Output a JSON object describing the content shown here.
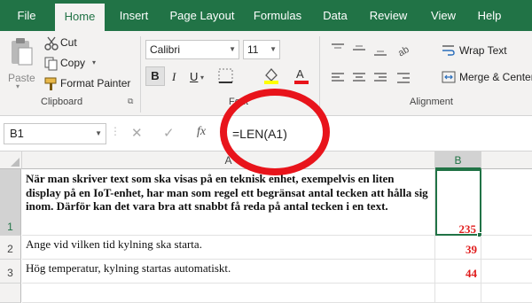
{
  "ribbon_tabs": [
    {
      "label": "File"
    },
    {
      "label": "Home",
      "active": true
    },
    {
      "label": "Insert"
    },
    {
      "label": "Page Layout"
    },
    {
      "label": "Formulas"
    },
    {
      "label": "Data"
    },
    {
      "label": "Review"
    },
    {
      "label": "View"
    },
    {
      "label": "Help"
    }
  ],
  "clipboard": {
    "paste_label": "Paste",
    "cut_label": "Cut",
    "copy_label": "Copy",
    "format_painter_label": "Format Painter",
    "group_label": "Clipboard"
  },
  "font": {
    "family": "Calibri",
    "size": "11",
    "bold": "B",
    "italic": "I",
    "underline": "U",
    "group_label": "Font"
  },
  "alignment": {
    "wrap_text_label": "Wrap Text",
    "merge_center_label": "Merge & Center",
    "group_label": "Alignment"
  },
  "formula_bar": {
    "name_box": "B1",
    "fx_label": "fx",
    "formula": "=LEN(A1)"
  },
  "sheet": {
    "columns": [
      "A",
      "B"
    ],
    "rows": [
      {
        "num": "1",
        "a": "När man skriver text som ska visas på en teknisk enhet, exempelvis en liten display på en IoT-enhet, har man som regel ett begränsat antal tecken att hålla sig inom. Därför kan det vara bra att snabbt få reda på antal tecken i en text.",
        "b": "235"
      },
      {
        "num": "2",
        "a": "Ange vid vilken tid kylning ska starta.",
        "b": "39"
      },
      {
        "num": "3",
        "a": "Hög temperatur, kylning startas automatiskt.",
        "b": "44"
      }
    ]
  },
  "colors": {
    "excel_green": "#217346",
    "highlight_circle": "#e8141b",
    "value_red": "#e01b1b"
  }
}
